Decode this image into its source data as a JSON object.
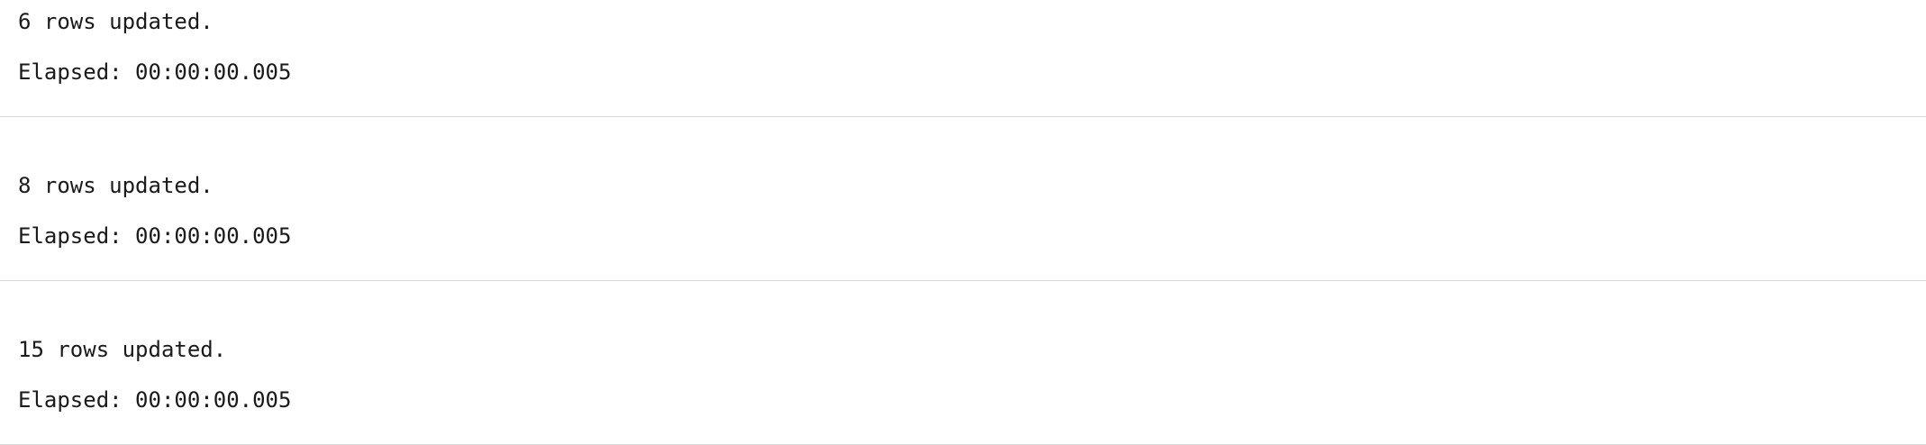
{
  "results": [
    {
      "message": "6 rows updated.",
      "elapsed": "Elapsed: 00:00:00.005"
    },
    {
      "message": "8 rows updated.",
      "elapsed": "Elapsed: 00:00:00.005"
    },
    {
      "message": "15 rows updated.",
      "elapsed": "Elapsed: 00:00:00.005"
    }
  ]
}
